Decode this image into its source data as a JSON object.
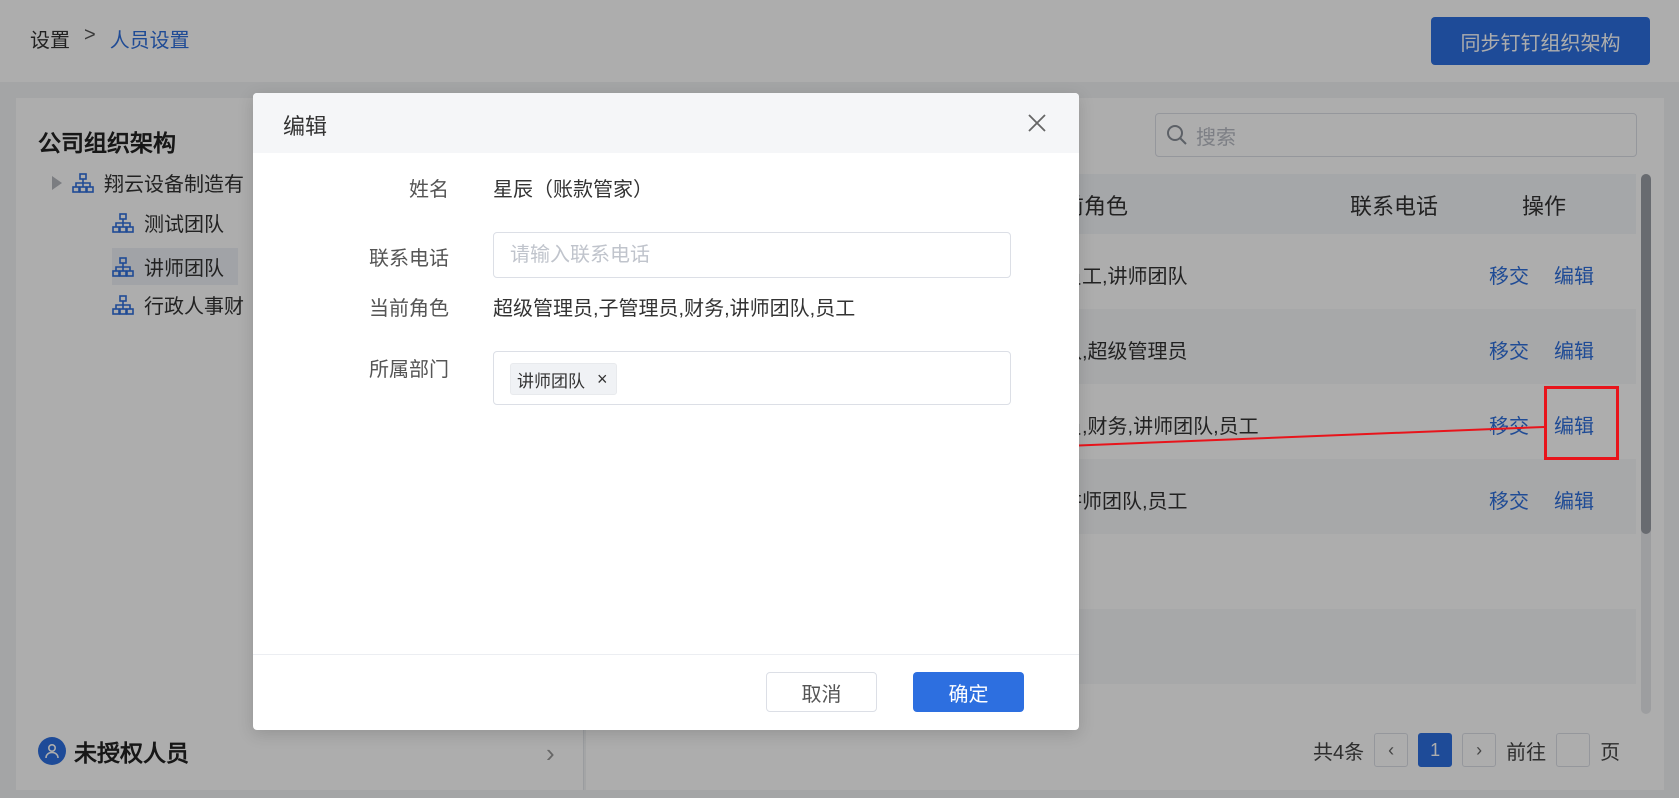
{
  "breadcrumb": {
    "root": "设置",
    "separator": ">",
    "current": "人员设置"
  },
  "header": {
    "sync_button": "同步钉钉组织架构"
  },
  "left": {
    "title": "公司组织架构",
    "tree": {
      "root": "翔云设备制造有",
      "children": [
        "测试团队",
        "讲师团队",
        "行政人事财"
      ]
    },
    "unauthorized": "未授权人员"
  },
  "right": {
    "search_placeholder": "搜索",
    "columns": {
      "role": "前角色",
      "phone": "联系电话",
      "actions": "操作"
    },
    "rows": [
      {
        "role": "员工,讲师团队",
        "transfer": "移交",
        "edit": "编辑"
      },
      {
        "role": "队,超级管理员",
        "transfer": "移交",
        "edit": "编辑"
      },
      {
        "role": "员,财务,讲师团队,员工",
        "transfer": "移交",
        "edit": "编辑"
      },
      {
        "role": "讲师团队,员工",
        "transfer": "移交",
        "edit": "编辑"
      }
    ],
    "pagination": {
      "total": "共4条",
      "current_page": "1",
      "goto_label": "前往",
      "page_unit": "页"
    }
  },
  "modal": {
    "title": "编辑",
    "fields": {
      "name_label": "姓名",
      "name_value": "星辰（账款管家）",
      "phone_label": "联系电话",
      "phone_placeholder": "请输入联系电话",
      "role_label": "当前角色",
      "role_value": "超级管理员,子管理员,财务,讲师团队,员工",
      "dept_label": "所属部门",
      "dept_tag": "讲师团队",
      "dept_tag_remove": "×"
    },
    "cancel_label": "取消",
    "confirm_label": "确定"
  },
  "colors": {
    "primary": "#2d6fe0",
    "annotation": "#e8141b"
  }
}
